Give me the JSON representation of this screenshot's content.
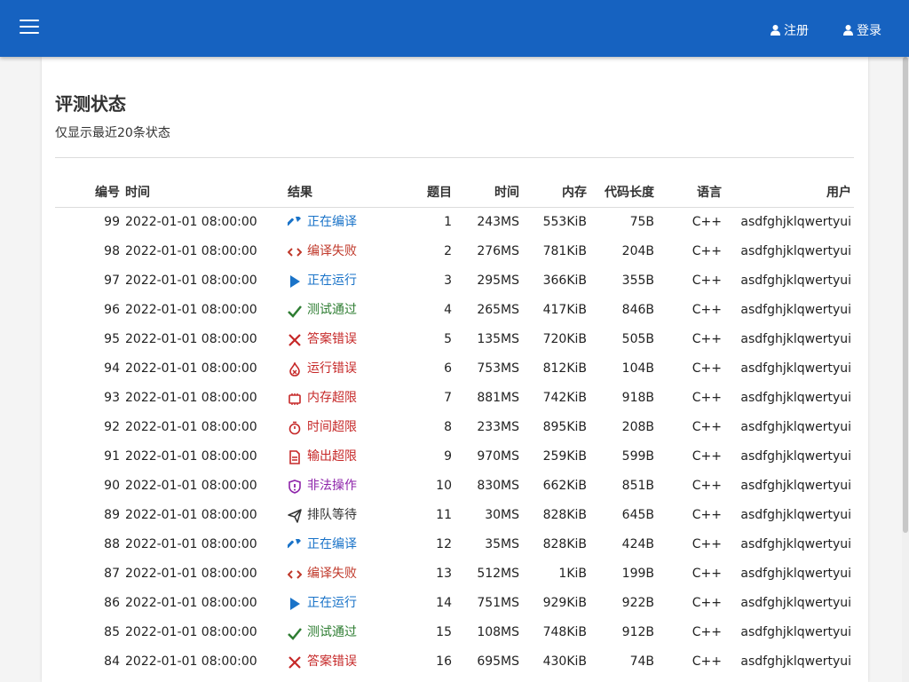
{
  "nav": {
    "register_label": "注册",
    "login_label": "登录"
  },
  "page": {
    "title": "评测状态",
    "subtitle": "仅显示最近20条状态"
  },
  "columns": {
    "id": "编号",
    "time": "时间",
    "result": "结果",
    "problem": "题目",
    "run_time": "时间",
    "memory": "内存",
    "code_length": "代码长度",
    "language": "语言",
    "user": "用户"
  },
  "status_styles": {
    "正在编译": {
      "icon": "hammer-icon",
      "color": "#1a73c8"
    },
    "编译失败": {
      "icon": "code-icon",
      "color": "#c0392b"
    },
    "正在运行": {
      "icon": "play-icon",
      "color": "#1a73c8"
    },
    "测试通过": {
      "icon": "check-icon",
      "color": "#2e7d32"
    },
    "答案错误": {
      "icon": "x-icon",
      "color": "#c62828"
    },
    "运行错误": {
      "icon": "fire-icon",
      "color": "#c62828"
    },
    "内存超限": {
      "icon": "chip-icon",
      "color": "#c62828"
    },
    "时间超限": {
      "icon": "stopwatch-icon",
      "color": "#c62828"
    },
    "输出超限": {
      "icon": "document-icon",
      "color": "#c62828"
    },
    "非法操作": {
      "icon": "shield-icon",
      "color": "#8e24aa"
    },
    "排队等待": {
      "icon": "paper-plane-icon",
      "color": "#333333"
    }
  },
  "submissions": [
    {
      "id": "99",
      "time": "2022-01-01 08:00:00",
      "result": "正在编译",
      "problem": "1",
      "run_time": "243MS",
      "memory": "553KiB",
      "code_length": "75B",
      "language": "C++",
      "user": "asdfghjklqwertyui"
    },
    {
      "id": "98",
      "time": "2022-01-01 08:00:00",
      "result": "编译失败",
      "problem": "2",
      "run_time": "276MS",
      "memory": "781KiB",
      "code_length": "204B",
      "language": "C++",
      "user": "asdfghjklqwertyui"
    },
    {
      "id": "97",
      "time": "2022-01-01 08:00:00",
      "result": "正在运行",
      "problem": "3",
      "run_time": "295MS",
      "memory": "366KiB",
      "code_length": "355B",
      "language": "C++",
      "user": "asdfghjklqwertyui"
    },
    {
      "id": "96",
      "time": "2022-01-01 08:00:00",
      "result": "测试通过",
      "problem": "4",
      "run_time": "265MS",
      "memory": "417KiB",
      "code_length": "846B",
      "language": "C++",
      "user": "asdfghjklqwertyui"
    },
    {
      "id": "95",
      "time": "2022-01-01 08:00:00",
      "result": "答案错误",
      "problem": "5",
      "run_time": "135MS",
      "memory": "720KiB",
      "code_length": "505B",
      "language": "C++",
      "user": "asdfghjklqwertyui"
    },
    {
      "id": "94",
      "time": "2022-01-01 08:00:00",
      "result": "运行错误",
      "problem": "6",
      "run_time": "753MS",
      "memory": "812KiB",
      "code_length": "104B",
      "language": "C++",
      "user": "asdfghjklqwertyui"
    },
    {
      "id": "93",
      "time": "2022-01-01 08:00:00",
      "result": "内存超限",
      "problem": "7",
      "run_time": "881MS",
      "memory": "742KiB",
      "code_length": "918B",
      "language": "C++",
      "user": "asdfghjklqwertyui"
    },
    {
      "id": "92",
      "time": "2022-01-01 08:00:00",
      "result": "时间超限",
      "problem": "8",
      "run_time": "233MS",
      "memory": "895KiB",
      "code_length": "208B",
      "language": "C++",
      "user": "asdfghjklqwertyui"
    },
    {
      "id": "91",
      "time": "2022-01-01 08:00:00",
      "result": "输出超限",
      "problem": "9",
      "run_time": "970MS",
      "memory": "259KiB",
      "code_length": "599B",
      "language": "C++",
      "user": "asdfghjklqwertyui"
    },
    {
      "id": "90",
      "time": "2022-01-01 08:00:00",
      "result": "非法操作",
      "problem": "10",
      "run_time": "830MS",
      "memory": "662KiB",
      "code_length": "851B",
      "language": "C++",
      "user": "asdfghjklqwertyui"
    },
    {
      "id": "89",
      "time": "2022-01-01 08:00:00",
      "result": "排队等待",
      "problem": "11",
      "run_time": "30MS",
      "memory": "828KiB",
      "code_length": "645B",
      "language": "C++",
      "user": "asdfghjklqwertyui"
    },
    {
      "id": "88",
      "time": "2022-01-01 08:00:00",
      "result": "正在编译",
      "problem": "12",
      "run_time": "35MS",
      "memory": "828KiB",
      "code_length": "424B",
      "language": "C++",
      "user": "asdfghjklqwertyui"
    },
    {
      "id": "87",
      "time": "2022-01-01 08:00:00",
      "result": "编译失败",
      "problem": "13",
      "run_time": "512MS",
      "memory": "1KiB",
      "code_length": "199B",
      "language": "C++",
      "user": "asdfghjklqwertyui"
    },
    {
      "id": "86",
      "time": "2022-01-01 08:00:00",
      "result": "正在运行",
      "problem": "14",
      "run_time": "751MS",
      "memory": "929KiB",
      "code_length": "922B",
      "language": "C++",
      "user": "asdfghjklqwertyui"
    },
    {
      "id": "85",
      "time": "2022-01-01 08:00:00",
      "result": "测试通过",
      "problem": "15",
      "run_time": "108MS",
      "memory": "748KiB",
      "code_length": "912B",
      "language": "C++",
      "user": "asdfghjklqwertyui"
    },
    {
      "id": "84",
      "time": "2022-01-01 08:00:00",
      "result": "答案错误",
      "problem": "16",
      "run_time": "695MS",
      "memory": "430KiB",
      "code_length": "74B",
      "language": "C++",
      "user": "asdfghjklqwertyui"
    }
  ]
}
